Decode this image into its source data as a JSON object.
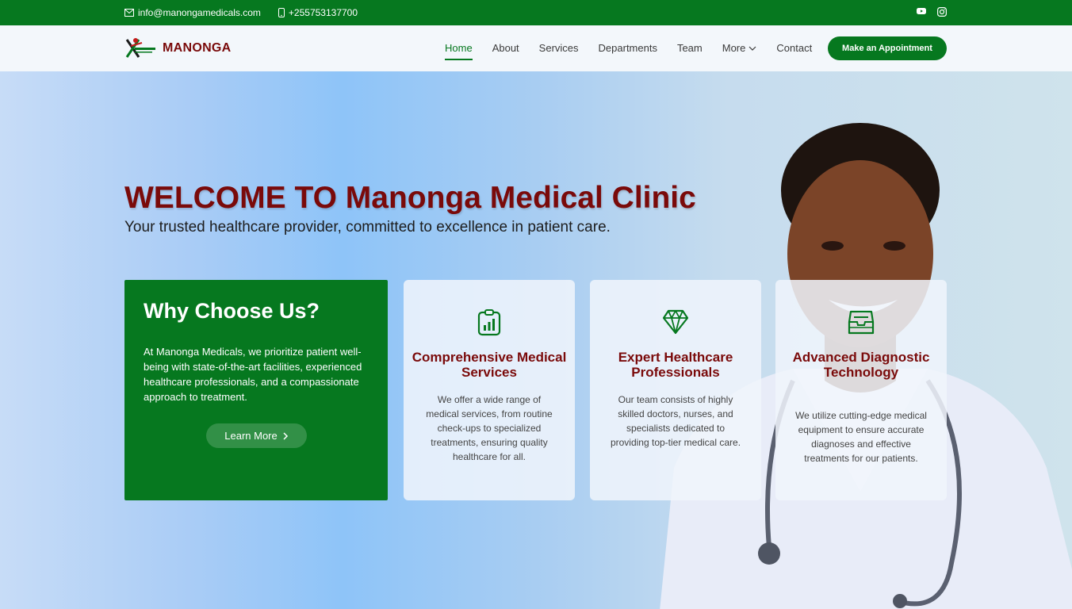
{
  "topbar": {
    "email": "info@manongamedicals.com",
    "phone": "+255753137700",
    "social": [
      "youtube-icon",
      "instagram-icon"
    ]
  },
  "header": {
    "brand": "MANONGA",
    "nav": [
      {
        "label": "Home",
        "active": true
      },
      {
        "label": "About"
      },
      {
        "label": "Services"
      },
      {
        "label": "Departments"
      },
      {
        "label": "Team"
      },
      {
        "label": "More",
        "dropdown": true
      },
      {
        "label": "Contact"
      }
    ],
    "cta": "Make an Appointment"
  },
  "hero": {
    "title": "WELCOME TO Manonga Medical Clinic",
    "subtitle": "Your trusted healthcare provider, committed to excellence in patient care."
  },
  "why": {
    "title": "Why Choose Us?",
    "text": "At Manonga Medicals, we prioritize patient well-being with state-of-the-art facilities, experienced healthcare professionals, and a compassionate approach to treatment.",
    "button": "Learn More"
  },
  "cards": [
    {
      "icon": "clipboard-chart-icon",
      "title": "Comprehensive Medical Services",
      "text": "We offer a wide range of medical services, from routine check-ups to specialized treatments, ensuring quality healthcare for all."
    },
    {
      "icon": "gem-icon",
      "title": "Expert Healthcare Professionals",
      "text": "Our team consists of highly skilled doctors, nurses, and specialists dedicated to providing top-tier medical care."
    },
    {
      "icon": "inbox-icon",
      "title": "Advanced Diagnostic Technology",
      "text": "We utilize cutting-edge medical equipment to ensure accurate diagnoses and effective treatments for our patients."
    }
  ],
  "colors": {
    "primary_green": "#06781f",
    "accent_maroon": "#7a0a0a"
  }
}
